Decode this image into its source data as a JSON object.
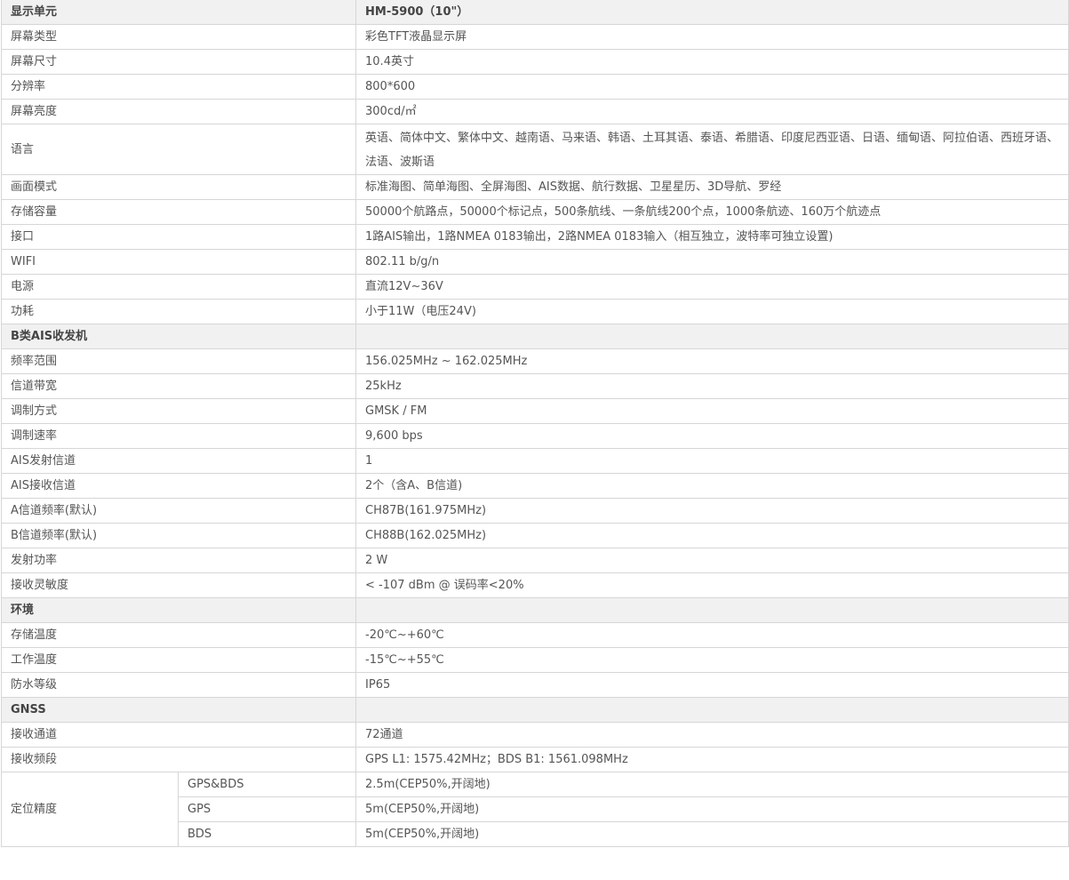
{
  "sections": [
    {
      "title": "显示单元",
      "title_value": "HM-5900（10\"）",
      "rows": [
        {
          "label": "屏幕类型",
          "value": "彩色TFT液晶显示屏"
        },
        {
          "label": "屏幕尺寸",
          "value": "10.4英寸"
        },
        {
          "label": "分辨率",
          "value": "800*600"
        },
        {
          "label": "屏幕亮度",
          "value": "300cd/㎡"
        },
        {
          "label": "语言",
          "value": "英语、简体中文、繁体中文、越南语、马来语、韩语、土耳其语、泰语、希腊语、印度尼西亚语、日语、缅甸语、阿拉伯语、西班牙语、法语、波斯语"
        },
        {
          "label": "画面模式",
          "value": "标准海图、简单海图、全屏海图、AIS数据、航行数据、卫星星历、3D导航、罗经"
        },
        {
          "label": "存储容量",
          "value": "50000个航路点，50000个标记点，500条航线、一条航线200个点，1000条航迹、160万个航迹点"
        },
        {
          "label": "接口",
          "value": "1路AIS输出，1路NMEA 0183输出，2路NMEA 0183输入（相互独立，波特率可独立设置)"
        },
        {
          "label": "WIFI",
          "value": "802.11 b/g/n"
        },
        {
          "label": "电源",
          "value": "直流12V~36V"
        },
        {
          "label": "功耗",
          "value": "小于11W（电压24V)"
        }
      ]
    },
    {
      "title": "B类AIS收发机",
      "title_value": "",
      "rows": [
        {
          "label": "频率范围",
          "value": "156.025MHz ~ 162.025MHz"
        },
        {
          "label": "信道带宽",
          "value": "25kHz"
        },
        {
          "label": "调制方式",
          "value": "GMSK / FM"
        },
        {
          "label": "调制速率",
          "value": "9,600 bps"
        },
        {
          "label": "AIS发射信道",
          "value": "1"
        },
        {
          "label": "AIS接收信道",
          "value": "2个（含A、B信道)"
        },
        {
          "label": "A信道频率(默认)",
          "value": "CH87B(161.975MHz)"
        },
        {
          "label": "B信道频率(默认)",
          "value": "CH88B(162.025MHz)"
        },
        {
          "label": "发射功率",
          "value": "2 W"
        },
        {
          "label": "接收灵敏度",
          "value": "< -107 dBm @ 误码率<20%"
        }
      ]
    },
    {
      "title": "环境",
      "title_value": "",
      "rows": [
        {
          "label": "存储温度",
          "value": "-20℃~+60℃"
        },
        {
          "label": "工作温度",
          "value": "-15℃~+55℃"
        },
        {
          "label": "防水等级",
          "value": "IP65"
        }
      ]
    },
    {
      "title": "GNSS",
      "title_value": "",
      "rows": [
        {
          "label": "接收通道",
          "value": "72通道"
        },
        {
          "label": "接收频段",
          "value": "GPS L1: 1575.42MHz；BDS B1: 1561.098MHz"
        }
      ],
      "accuracy": {
        "label": "定位精度",
        "rows": [
          {
            "system": "GPS&BDS",
            "value": "2.5m(CEP50%,开阔地)"
          },
          {
            "system": "GPS",
            "value": "5m(CEP50%,开阔地)"
          },
          {
            "system": "BDS",
            "value": "5m(CEP50%,开阔地)"
          }
        ]
      }
    }
  ]
}
